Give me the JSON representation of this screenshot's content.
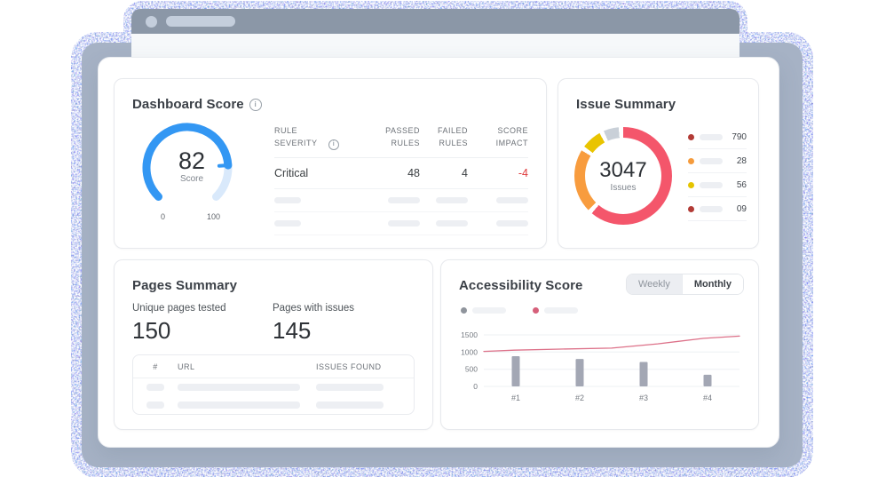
{
  "dashboard_score": {
    "title": "Dashboard Score",
    "gauge": {
      "score": "82",
      "score_label": "Score",
      "min_label": "0",
      "max_label": "100"
    },
    "table": {
      "headers": [
        "RULE SEVERITY",
        "PASSED RULES",
        "FAILED RULES",
        "SCORE IMPACT"
      ],
      "rows": [
        {
          "severity": "Critical",
          "passed": "48",
          "failed": "4",
          "impact": "-4"
        }
      ]
    }
  },
  "issue_summary": {
    "title": "Issue Summary",
    "total": "3047",
    "total_label": "Issues",
    "legend": [
      {
        "color": "#b23b36",
        "value": "790"
      },
      {
        "color": "#f59b3c",
        "value": "28"
      },
      {
        "color": "#e5c400",
        "value": "56"
      },
      {
        "color": "#b23b36",
        "value": "09"
      }
    ]
  },
  "pages_summary": {
    "title": "Pages Summary",
    "stats": [
      {
        "label": "Unique pages tested",
        "value": "150"
      },
      {
        "label": "Pages with issues",
        "value": "145"
      }
    ],
    "table_headers": [
      "#",
      "URL",
      "ISSUES FOUND"
    ]
  },
  "accessibility_score": {
    "title": "Accessibility Score",
    "toggle": {
      "weekly": "Weekly",
      "monthly": "Monthly",
      "selected": "Weekly"
    },
    "legend": [
      {
        "color": "#8f949c"
      },
      {
        "color": "#d6607a"
      }
    ]
  },
  "colors": {
    "gauge_blue": "#3397f3",
    "donut_red": "#f4566b",
    "donut_orange": "#f89c3e",
    "donut_yellow": "#e9c400",
    "impact_red": "#df3a3c",
    "backdrop": "#a6b2c5"
  },
  "chart_data": [
    {
      "id": "dashboard_score_gauge",
      "type": "gauge",
      "title": "Dashboard Score",
      "value": 82,
      "min": 0,
      "max": 100,
      "sweep_deg": 270,
      "color": "#3397f3",
      "track_color": "#d9e9fb",
      "center_label": "Score"
    },
    {
      "id": "issue_summary_donut",
      "type": "pie",
      "title": "Issue Summary",
      "center_value": "3047",
      "center_label": "Issues",
      "gap_deg": 5.5,
      "segments": [
        {
          "color": "#f4566b",
          "sweep_deg": 220
        },
        {
          "color": "#f89c3e",
          "sweep_deg": 76
        },
        {
          "color": "#e9c400",
          "sweep_deg": 24
        },
        {
          "color": "#c9d0d8",
          "sweep_deg": 18
        }
      ],
      "legend_values": [
        "790",
        "28",
        "56",
        "09"
      ]
    },
    {
      "id": "accessibility_chart",
      "type": "bar",
      "title": "Accessibility Score",
      "categories": [
        "#1",
        "#2",
        "#3",
        "#4"
      ],
      "ylim": [
        0,
        1500
      ],
      "yticks": [
        0,
        500,
        1000,
        1500
      ],
      "bars": {
        "color": "#a3a7b4",
        "values": [
          880,
          800,
          710,
          340
        ]
      },
      "line": {
        "color": "#dd7189",
        "points": [
          [
            0,
            1020
          ],
          [
            0.12,
            1055
          ],
          [
            0.3,
            1085
          ],
          [
            0.5,
            1115
          ],
          [
            0.68,
            1240
          ],
          [
            0.86,
            1400
          ],
          [
            1,
            1465
          ]
        ]
      }
    }
  ]
}
